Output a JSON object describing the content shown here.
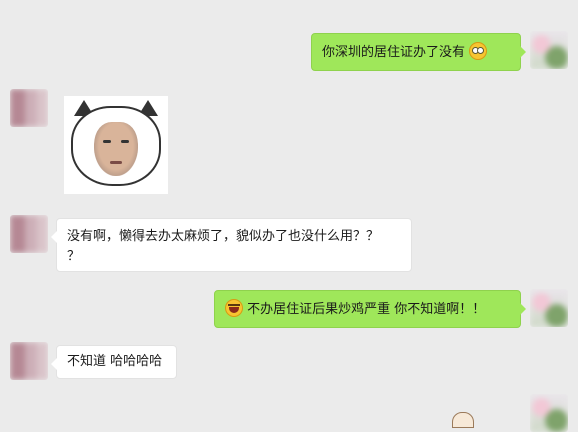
{
  "messages": [
    {
      "side": "out",
      "text": "你深圳的居住证办了没有",
      "emoji": "flushed-face-emoji"
    },
    {
      "side": "in",
      "type": "sticker",
      "sticker": "cat-head-face-sticker"
    },
    {
      "side": "in",
      "text": "没有啊，懒得去办太麻烦了，貌似办了也没什么用？？",
      "text2": "？"
    },
    {
      "side": "out",
      "emoji": "laughing-tears-emoji",
      "text": "不办居住证后果炒鸡严重 你不知道啊！！"
    },
    {
      "side": "in",
      "text": "不知道 哈哈哈哈"
    }
  ],
  "colors": {
    "background": "#ebebeb",
    "out_bubble": "#9fe75a",
    "in_bubble": "#ffffff"
  }
}
